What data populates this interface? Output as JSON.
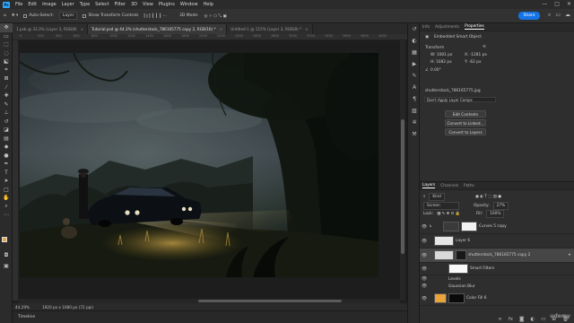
{
  "menubar": {
    "logo": "Ps",
    "items": [
      "File",
      "Edit",
      "Image",
      "Layer",
      "Type",
      "Select",
      "Filter",
      "3D",
      "View",
      "Plugins",
      "Window",
      "Help"
    ],
    "window_controls": [
      "—",
      "□",
      "✕"
    ]
  },
  "options": {
    "auto_select_label": "Auto-Select:",
    "auto_select_value": "Layer",
    "transform_label": "Show Transform Controls",
    "mode_3d": "3D Mode:",
    "share_label": "Share"
  },
  "tabs": [
    {
      "label": "1.psb @ 33.3% (Layer 3, RGB/8)",
      "active": false
    },
    {
      "label": "Tutorial.psd @ 44.3% (shutterstock_786165775 copy 2, RGB/16) *",
      "active": true
    },
    {
      "label": "Untitled-1 @ 115% (Layer 3, RGB/8) *",
      "active": false
    }
  ],
  "ruler_ticks": [
    "0",
    "200",
    "400",
    "600",
    "800",
    "1000",
    "1200",
    "1400",
    "1600",
    "1800",
    "2000",
    "2200",
    "2400",
    "2600",
    "2800",
    "3000",
    "3200",
    "3400",
    "3600",
    "3800",
    "4000"
  ],
  "status": {
    "zoom": "44.29%",
    "size": "1920 px x 1080 px (72 ppi)",
    "timeline": "Timeline"
  },
  "properties": {
    "tabs": [
      "Info",
      "Adjustments",
      "Properties"
    ],
    "object_type": "Embedded Smart Object",
    "transform_title": "Transform",
    "w": "W: 1081 px",
    "h": "H: 1082 px",
    "x": "X: -1281 px",
    "y": "Y: -62 px",
    "angle": "0.00°",
    "filename": "shutterstock_786165775.jpg",
    "layer_comps": "Don't Apply Layer Comps",
    "edit_contents": "Edit Contents",
    "convert_linked": "Convert to Linked...",
    "convert_layers": "Convert to Layers"
  },
  "layers_panel": {
    "tabs": [
      "Layers",
      "Channels",
      "Paths"
    ],
    "filter_kind": "Kind",
    "blend_mode": "Screen",
    "opacity_label": "Opacity:",
    "opacity_value": "27%",
    "lock_label": "Lock:",
    "fill_label": "Fill:",
    "fill_value": "100%",
    "rows": [
      {
        "name": "Curves 5 copy",
        "selected": false
      },
      {
        "name": "Layer 6",
        "selected": false
      },
      {
        "name": "shutterstock_786165775 copy 2",
        "selected": true
      },
      {
        "name": "Smart Filters",
        "selected": false
      },
      {
        "name": "Levels",
        "selected": false
      },
      {
        "name": "Gaussian Blur",
        "selected": false
      },
      {
        "name": "Color Fill 6",
        "selected": false
      }
    ]
  },
  "watermark": "udemy",
  "colors": {
    "accent": "#1473e6",
    "foreground_swatch": "#e8a33a",
    "background_swatch": "#111111"
  }
}
